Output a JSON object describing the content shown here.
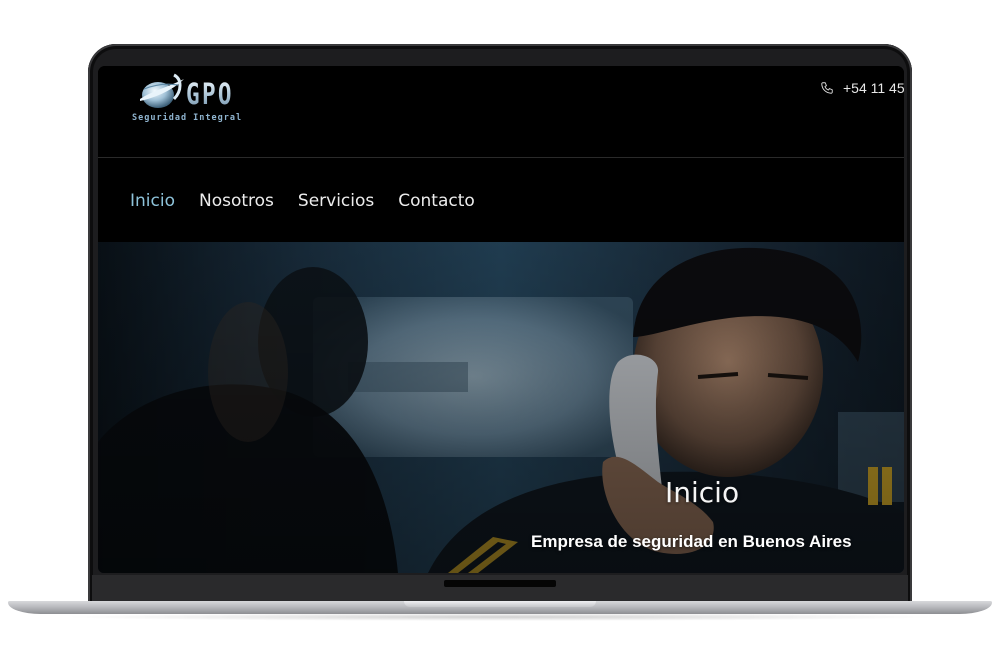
{
  "brand": {
    "name": "GPO",
    "tagline": "Seguridad Integral"
  },
  "header": {
    "phone": "+54 11 45"
  },
  "nav": {
    "items": [
      {
        "label": "Inicio",
        "active": true
      },
      {
        "label": "Nosotros",
        "active": false
      },
      {
        "label": "Servicios",
        "active": false
      },
      {
        "label": "Contacto",
        "active": false
      }
    ]
  },
  "hero": {
    "title": "Inicio",
    "subtitle": "Empresa de seguridad en Buenos Aires"
  },
  "colors": {
    "nav_active": "#8ec3da",
    "page_background": "#000000",
    "logo_blue": "#a9c3d6"
  },
  "icons": {
    "logo": "globe-swoosh-icon",
    "phone": "phone-icon"
  }
}
